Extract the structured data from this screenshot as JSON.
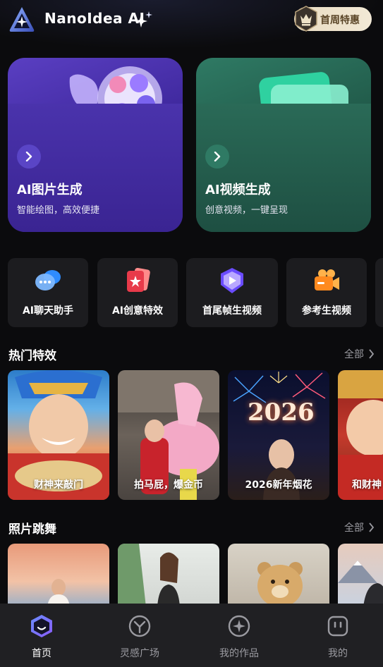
{
  "header": {
    "app_name": "NanoIdea AI",
    "promo_label": "首周特惠",
    "logo_icon": "nanoidea-logo-icon",
    "sparkle_icon": "sparkle-icon",
    "promo_icon": "crown-badge-icon"
  },
  "feature_cards": [
    {
      "title": "AI图片生成",
      "subtitle": "智能绘图，高效便捷",
      "icon": "palette-icon",
      "color": "#4a33ac"
    },
    {
      "title": "AI视频生成",
      "subtitle": "创意视频，一键呈现",
      "icon": "video-play-icon",
      "color": "#2a6a57"
    }
  ],
  "tools": [
    {
      "label": "AI聊天助手",
      "icon": "chat-bubbles-icon"
    },
    {
      "label": "AI创意特效",
      "icon": "star-cards-icon"
    },
    {
      "label": "首尾帧生视频",
      "icon": "video-shield-icon"
    },
    {
      "label": "参考生视频",
      "icon": "video-camera-icon"
    }
  ],
  "hot_effects": {
    "title": "热门特效",
    "all_label": "全部",
    "items": [
      {
        "caption": "财神来敲门"
      },
      {
        "caption": "拍马屁，爆金币"
      },
      {
        "caption": "2026新年烟花",
        "overlay_text": "2026"
      },
      {
        "caption": "和财神"
      }
    ]
  },
  "photo_dance": {
    "title": "照片跳舞",
    "all_label": "全部"
  },
  "bottom_nav": [
    {
      "label": "首页",
      "icon": "home-face-icon",
      "active": true
    },
    {
      "label": "灵感广场",
      "icon": "inspiration-y-icon",
      "active": false
    },
    {
      "label": "我的作品",
      "icon": "sparkle-works-icon",
      "active": false
    },
    {
      "label": "我的",
      "icon": "profile-face-icon",
      "active": false
    }
  ]
}
